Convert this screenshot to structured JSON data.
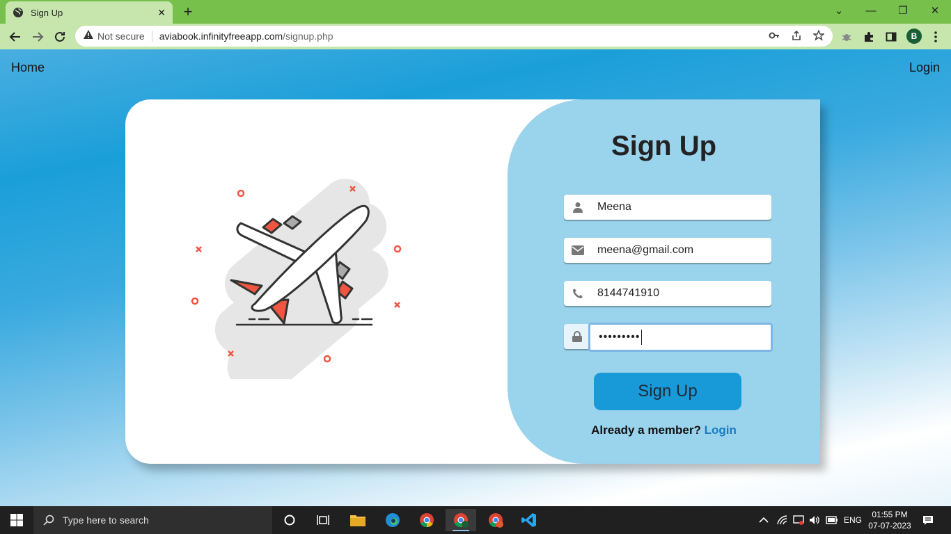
{
  "browser": {
    "tab_title": "Sign Up",
    "security_label": "Not secure",
    "url_host": "aviabook.infinityfreeapp.com",
    "url_path": "/signup.php",
    "profile_initial": "B"
  },
  "nav": {
    "home": "Home",
    "login": "Login"
  },
  "form": {
    "title": "Sign Up",
    "name_value": "Meena",
    "email_value": "meena@gmail.com",
    "phone_value": "8144741910",
    "password_mask": "•••••••••",
    "submit_label": "Sign Up",
    "member_text": "Already a member?",
    "member_link": "Login"
  },
  "taskbar": {
    "search_placeholder": "Type here to search",
    "language": "ENG",
    "time": "01:55 PM",
    "date": "07-07-2023"
  },
  "colors": {
    "accent": "#199ad8",
    "panel": "#9ad3ec",
    "chrome": "#76c04b",
    "link": "#1b7bbf",
    "plane_red": "#f05542"
  }
}
